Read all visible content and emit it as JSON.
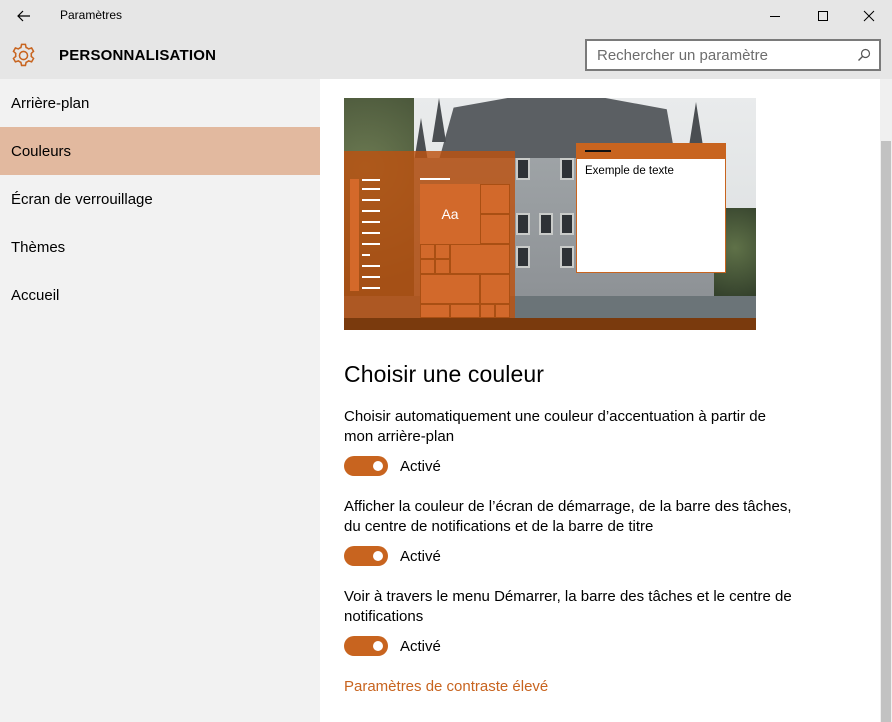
{
  "window": {
    "title": "Paramètres",
    "controls": [
      "minimize-icon",
      "maximize-icon",
      "close-icon"
    ]
  },
  "header": {
    "title": "PERSONNALISATION",
    "search": {
      "placeholder": "Rechercher un paramètre",
      "value": ""
    }
  },
  "sidebar": {
    "items": [
      {
        "label": "Arrière-plan",
        "active": false
      },
      {
        "label": "Couleurs",
        "active": true
      },
      {
        "label": "Écran de verrouillage",
        "active": false
      },
      {
        "label": "Thèmes",
        "active": false
      },
      {
        "label": "Accueil",
        "active": false
      }
    ]
  },
  "preview": {
    "tile_label": "Aa",
    "sample_text": "Exemple de texte"
  },
  "main": {
    "section_title": "Choisir une couleur",
    "settings": [
      {
        "label": "Choisir automatiquement une couleur d’accentuation à partir de mon arrière-plan",
        "toggle_state": "Activé",
        "on": true
      },
      {
        "label": "Afficher la couleur de l’écran de démarrage, de la barre des tâches, du centre de notifications et de la barre de titre",
        "toggle_state": "Activé",
        "on": true
      },
      {
        "label": "Voir à travers le menu Démarrer, la barre des tâches et le centre de notifications",
        "toggle_state": "Activé",
        "on": true
      }
    ],
    "link": "Paramètres de contraste élevé"
  },
  "colors": {
    "accent": "#c8641f",
    "sidebar_active": "#e2b99f",
    "chrome": "#e6e6e6",
    "sidebar_bg": "#f2f2f2"
  }
}
